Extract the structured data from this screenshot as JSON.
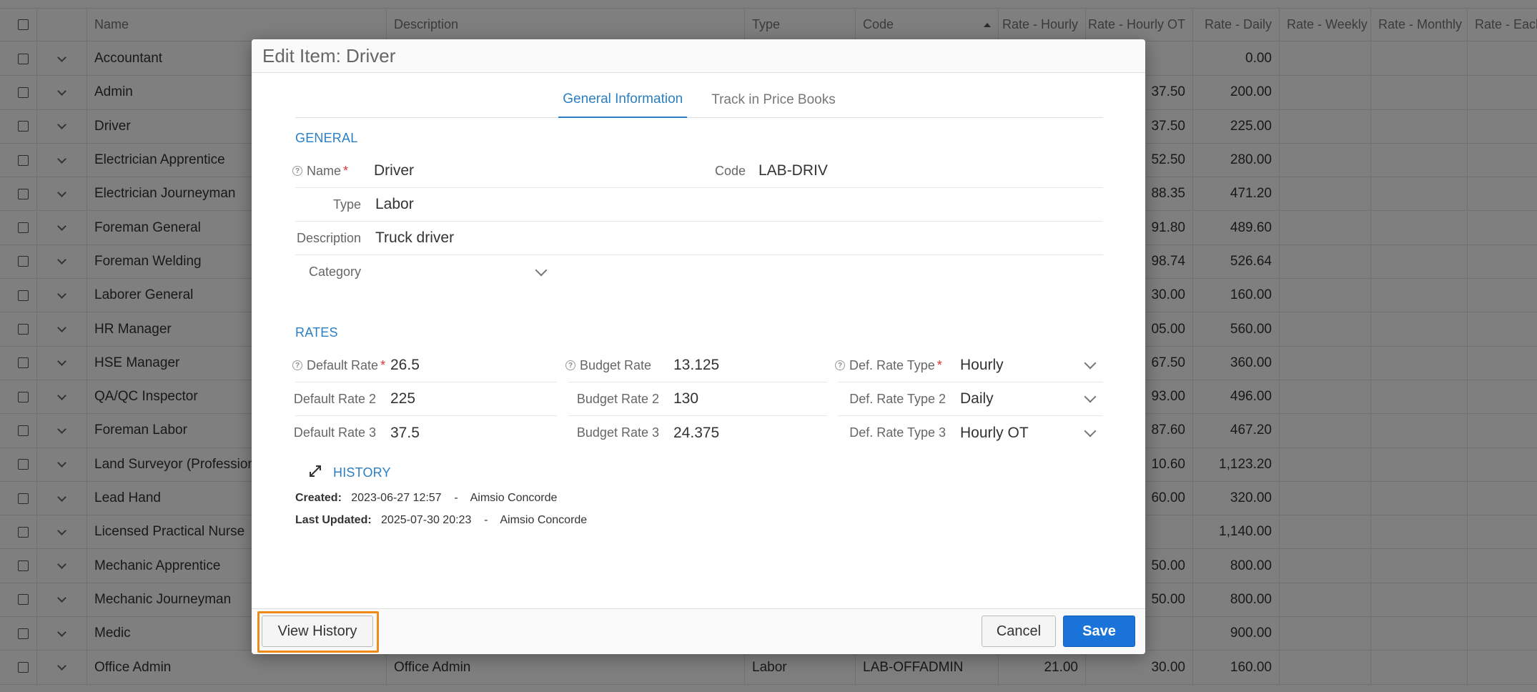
{
  "grid": {
    "headers": {
      "name": "Name",
      "description": "Description",
      "type": "Type",
      "code": "Code",
      "rate_hourly": "Rate - Hourly",
      "rate_hourly_ot": "Rate - Hourly OT",
      "rate_daily": "Rate - Daily",
      "rate_weekly": "Rate - Weekly",
      "rate_monthly": "Rate - Monthly",
      "rate_each": "Rate - Each"
    },
    "rows": [
      {
        "name": "Accountant",
        "description": "",
        "type": "",
        "code": "",
        "rh": "",
        "rhot": "",
        "rd": "0.00"
      },
      {
        "name": "Admin",
        "description": "",
        "type": "",
        "code": "",
        "rh": "",
        "rhot": "37.50",
        "rd": "200.00"
      },
      {
        "name": "Driver",
        "description": "",
        "type": "",
        "code": "",
        "rh": "",
        "rhot": "37.50",
        "rd": "225.00"
      },
      {
        "name": "Electrician Apprentice",
        "description": "",
        "type": "",
        "code": "",
        "rh": "",
        "rhot": "52.50",
        "rd": "280.00"
      },
      {
        "name": "Electrician Journeyman",
        "description": "",
        "type": "",
        "code": "",
        "rh": "",
        "rhot": "88.35",
        "rd": "471.20"
      },
      {
        "name": "Foreman General",
        "description": "",
        "type": "",
        "code": "",
        "rh": "",
        "rhot": "91.80",
        "rd": "489.60"
      },
      {
        "name": "Foreman Welding",
        "description": "",
        "type": "",
        "code": "",
        "rh": "",
        "rhot": "98.74",
        "rd": "526.64"
      },
      {
        "name": "Laborer General",
        "description": "",
        "type": "",
        "code": "",
        "rh": "",
        "rhot": "30.00",
        "rd": "160.00"
      },
      {
        "name": "HR Manager",
        "description": "",
        "type": "",
        "code": "",
        "rh": "",
        "rhot": "05.00",
        "rd": "560.00"
      },
      {
        "name": "HSE Manager",
        "description": "",
        "type": "",
        "code": "",
        "rh": "",
        "rhot": "67.50",
        "rd": "360.00"
      },
      {
        "name": "QA/QC Inspector",
        "description": "",
        "type": "",
        "code": "",
        "rh": "",
        "rhot": "93.00",
        "rd": "496.00"
      },
      {
        "name": "Foreman Labor",
        "description": "",
        "type": "",
        "code": "",
        "rh": "",
        "rhot": "87.60",
        "rd": "467.20"
      },
      {
        "name": "Land Surveyor (Professional)",
        "description": "",
        "type": "",
        "code": "",
        "rh": "",
        "rhot": "10.60",
        "rd": "1,123.20"
      },
      {
        "name": "Lead Hand",
        "description": "",
        "type": "",
        "code": "",
        "rh": "",
        "rhot": "60.00",
        "rd": "320.00"
      },
      {
        "name": "Licensed Practical Nurse",
        "description": "",
        "type": "",
        "code": "",
        "rh": "",
        "rhot": "",
        "rd": "1,140.00"
      },
      {
        "name": "Mechanic Apprentice",
        "description": "",
        "type": "",
        "code": "",
        "rh": "",
        "rhot": "50.00",
        "rd": "800.00"
      },
      {
        "name": "Mechanic Journeyman",
        "description": "",
        "type": "",
        "code": "",
        "rh": "",
        "rhot": "50.00",
        "rd": "800.00"
      },
      {
        "name": "Medic",
        "description": "",
        "type": "",
        "code": "",
        "rh": "",
        "rhot": "",
        "rd": "900.00"
      },
      {
        "name": "Office Admin",
        "description": "Office Admin",
        "type": "Labor",
        "code": "LAB-OFFADMIN",
        "rh": "21.00",
        "rhot": "30.00",
        "rd": "160.00"
      }
    ]
  },
  "modal": {
    "title": "Edit Item: Driver",
    "tabs": [
      "General Information",
      "Track in Price Books"
    ],
    "general": {
      "section_title": "GENERAL",
      "name_label": "Name",
      "name_value": "Driver",
      "code_label": "Code",
      "code_value": "LAB-DRIV",
      "type_label": "Type",
      "type_value": "Labor",
      "description_label": "Description",
      "description_value": "Truck driver",
      "category_label": "Category",
      "category_value": ""
    },
    "rates": {
      "section_title": "RATES",
      "default_rate_label": "Default Rate",
      "default_rate": "26.5",
      "default_rate_2_label": "Default Rate 2",
      "default_rate_2": "225",
      "default_rate_3_label": "Default Rate 3",
      "default_rate_3": "37.5",
      "budget_rate_label": "Budget Rate",
      "budget_rate": "13.125",
      "budget_rate_2_label": "Budget Rate 2",
      "budget_rate_2": "130",
      "budget_rate_3_label": "Budget Rate 3",
      "budget_rate_3": "24.375",
      "def_rate_type_label": "Def. Rate Type",
      "def_rate_type": "Hourly",
      "def_rate_type_2_label": "Def. Rate Type 2",
      "def_rate_type_2": "Daily",
      "def_rate_type_3_label": "Def. Rate Type 3",
      "def_rate_type_3": "Hourly OT"
    },
    "history": {
      "section_title": "HISTORY",
      "created_label": "Created:",
      "created_date": "2023-06-27 12:57",
      "created_by": "Aimsio Concorde",
      "updated_label": "Last Updated:",
      "updated_date": "2025-07-30 20:23",
      "updated_by": "Aimsio Concorde",
      "separator": "-"
    },
    "buttons": {
      "view_history": "View History",
      "cancel": "Cancel",
      "save": "Save"
    },
    "colors": {
      "accent": "#2a7fc4",
      "primary_button": "#1a73d9",
      "focus_ring": "#ee8a1a",
      "required": "#d33333"
    }
  }
}
